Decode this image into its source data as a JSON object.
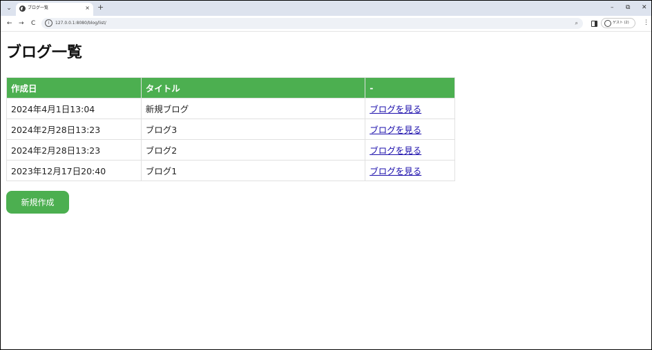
{
  "browser": {
    "tab_title": "ブログ一覧",
    "tab_close": "×",
    "new_tab": "+",
    "window_controls": {
      "minimize": "–",
      "restore": "⧉",
      "close": "✕"
    },
    "nav": {
      "back": "←",
      "forward": "→",
      "reload": "C"
    },
    "url": "127.0.0.1:8080/blog/list/",
    "profile_label": "ゲスト (2)",
    "menu": "⋮"
  },
  "page": {
    "title": "ブログ一覧",
    "table": {
      "headers": [
        "作成日",
        "タイトル",
        "-"
      ],
      "rows": [
        {
          "date": "2024年4月1日13:04",
          "title": "新規ブログ",
          "link": "ブログを見る"
        },
        {
          "date": "2024年2月28日13:23",
          "title": "ブログ3",
          "link": "ブログを見る"
        },
        {
          "date": "2024年2月28日13:23",
          "title": "ブログ2",
          "link": "ブログを見る"
        },
        {
          "date": "2023年12月17日20:40",
          "title": "ブログ1",
          "link": "ブログを見る"
        }
      ]
    },
    "create_button": "新規作成"
  },
  "colors": {
    "accent": "#4caf50",
    "link": "#1a0dab"
  }
}
